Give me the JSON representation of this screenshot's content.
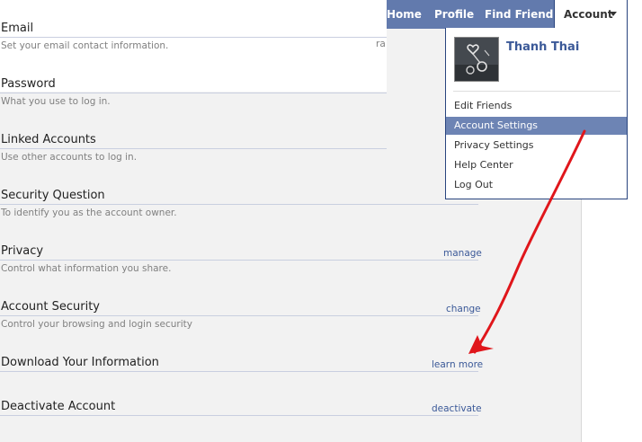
{
  "nav": {
    "home": "Home",
    "profile": "Profile",
    "find_friends": "Find Friends",
    "account": "Account"
  },
  "dropdown": {
    "user_name": "Thanh Thai",
    "items": [
      "Edit Friends",
      "Account Settings",
      "Privacy Settings",
      "Help Center",
      "Log Out"
    ],
    "active_index": 1
  },
  "settings": {
    "email": {
      "title": "Email",
      "desc": "Set your email contact information.",
      "partial": "ra"
    },
    "password": {
      "title": "Password",
      "desc": "What you use to log in."
    },
    "linked": {
      "title": "Linked Accounts",
      "desc": "Use other accounts to log in."
    },
    "security_question": {
      "title": "Security Question",
      "desc": "To identify you as the account owner."
    },
    "privacy": {
      "title": "Privacy",
      "desc": "Control what information you share.",
      "action": "manage"
    },
    "account_security": {
      "title": "Account Security",
      "desc": "Control your browsing and login security",
      "action": "change"
    },
    "download": {
      "title": "Download Your Information",
      "action": "learn more"
    },
    "deactivate": {
      "title": "Deactivate Account",
      "action": "deactivate"
    }
  },
  "colors": {
    "nav_blue": "#627aad",
    "link_blue": "#3b5998",
    "highlight": "#6d84b4",
    "annotation_red": "#e0161b"
  }
}
